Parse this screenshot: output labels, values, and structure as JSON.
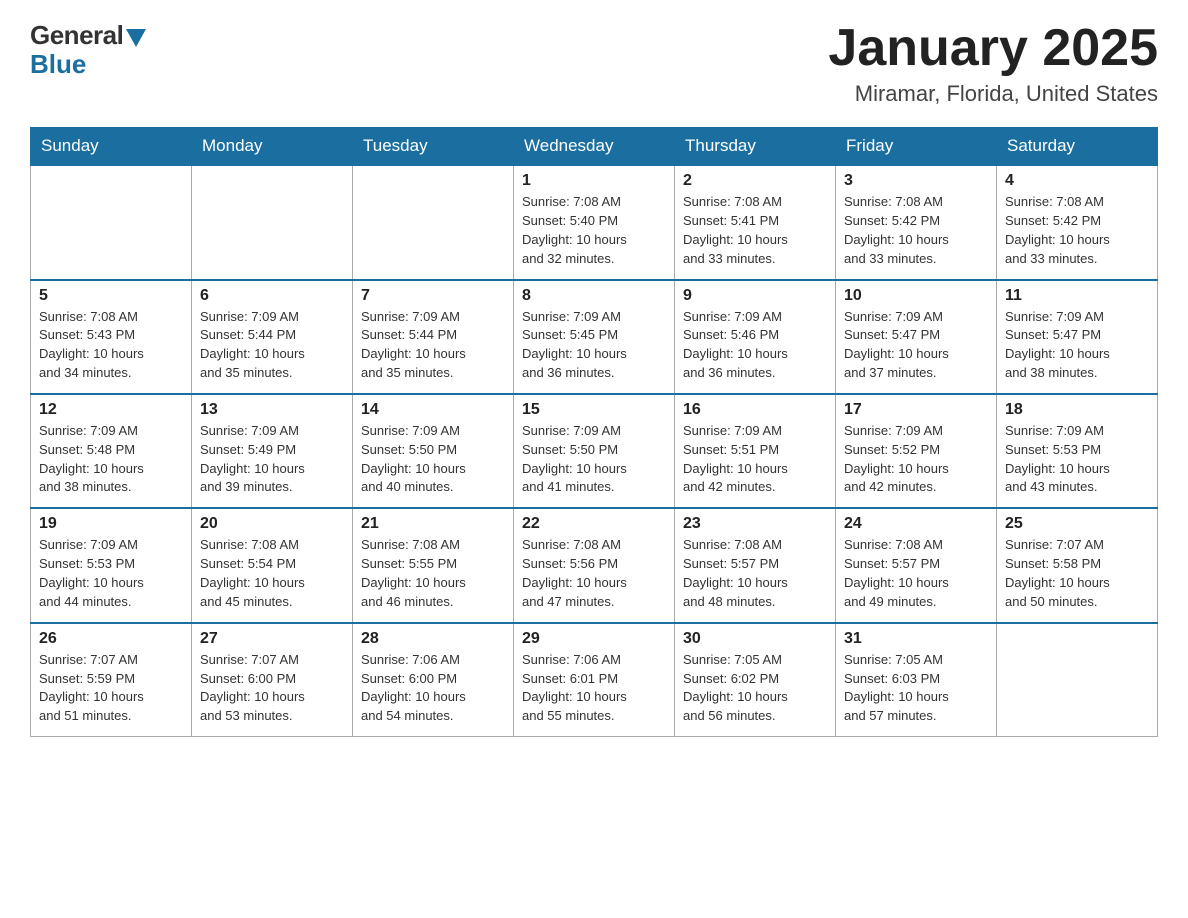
{
  "logo": {
    "general": "General",
    "blue": "Blue"
  },
  "title": "January 2025",
  "location": "Miramar, Florida, United States",
  "days_header": [
    "Sunday",
    "Monday",
    "Tuesday",
    "Wednesday",
    "Thursday",
    "Friday",
    "Saturday"
  ],
  "weeks": [
    [
      {
        "num": "",
        "info": ""
      },
      {
        "num": "",
        "info": ""
      },
      {
        "num": "",
        "info": ""
      },
      {
        "num": "1",
        "info": "Sunrise: 7:08 AM\nSunset: 5:40 PM\nDaylight: 10 hours\nand 32 minutes."
      },
      {
        "num": "2",
        "info": "Sunrise: 7:08 AM\nSunset: 5:41 PM\nDaylight: 10 hours\nand 33 minutes."
      },
      {
        "num": "3",
        "info": "Sunrise: 7:08 AM\nSunset: 5:42 PM\nDaylight: 10 hours\nand 33 minutes."
      },
      {
        "num": "4",
        "info": "Sunrise: 7:08 AM\nSunset: 5:42 PM\nDaylight: 10 hours\nand 33 minutes."
      }
    ],
    [
      {
        "num": "5",
        "info": "Sunrise: 7:08 AM\nSunset: 5:43 PM\nDaylight: 10 hours\nand 34 minutes."
      },
      {
        "num": "6",
        "info": "Sunrise: 7:09 AM\nSunset: 5:44 PM\nDaylight: 10 hours\nand 35 minutes."
      },
      {
        "num": "7",
        "info": "Sunrise: 7:09 AM\nSunset: 5:44 PM\nDaylight: 10 hours\nand 35 minutes."
      },
      {
        "num": "8",
        "info": "Sunrise: 7:09 AM\nSunset: 5:45 PM\nDaylight: 10 hours\nand 36 minutes."
      },
      {
        "num": "9",
        "info": "Sunrise: 7:09 AM\nSunset: 5:46 PM\nDaylight: 10 hours\nand 36 minutes."
      },
      {
        "num": "10",
        "info": "Sunrise: 7:09 AM\nSunset: 5:47 PM\nDaylight: 10 hours\nand 37 minutes."
      },
      {
        "num": "11",
        "info": "Sunrise: 7:09 AM\nSunset: 5:47 PM\nDaylight: 10 hours\nand 38 minutes."
      }
    ],
    [
      {
        "num": "12",
        "info": "Sunrise: 7:09 AM\nSunset: 5:48 PM\nDaylight: 10 hours\nand 38 minutes."
      },
      {
        "num": "13",
        "info": "Sunrise: 7:09 AM\nSunset: 5:49 PM\nDaylight: 10 hours\nand 39 minutes."
      },
      {
        "num": "14",
        "info": "Sunrise: 7:09 AM\nSunset: 5:50 PM\nDaylight: 10 hours\nand 40 minutes."
      },
      {
        "num": "15",
        "info": "Sunrise: 7:09 AM\nSunset: 5:50 PM\nDaylight: 10 hours\nand 41 minutes."
      },
      {
        "num": "16",
        "info": "Sunrise: 7:09 AM\nSunset: 5:51 PM\nDaylight: 10 hours\nand 42 minutes."
      },
      {
        "num": "17",
        "info": "Sunrise: 7:09 AM\nSunset: 5:52 PM\nDaylight: 10 hours\nand 42 minutes."
      },
      {
        "num": "18",
        "info": "Sunrise: 7:09 AM\nSunset: 5:53 PM\nDaylight: 10 hours\nand 43 minutes."
      }
    ],
    [
      {
        "num": "19",
        "info": "Sunrise: 7:09 AM\nSunset: 5:53 PM\nDaylight: 10 hours\nand 44 minutes."
      },
      {
        "num": "20",
        "info": "Sunrise: 7:08 AM\nSunset: 5:54 PM\nDaylight: 10 hours\nand 45 minutes."
      },
      {
        "num": "21",
        "info": "Sunrise: 7:08 AM\nSunset: 5:55 PM\nDaylight: 10 hours\nand 46 minutes."
      },
      {
        "num": "22",
        "info": "Sunrise: 7:08 AM\nSunset: 5:56 PM\nDaylight: 10 hours\nand 47 minutes."
      },
      {
        "num": "23",
        "info": "Sunrise: 7:08 AM\nSunset: 5:57 PM\nDaylight: 10 hours\nand 48 minutes."
      },
      {
        "num": "24",
        "info": "Sunrise: 7:08 AM\nSunset: 5:57 PM\nDaylight: 10 hours\nand 49 minutes."
      },
      {
        "num": "25",
        "info": "Sunrise: 7:07 AM\nSunset: 5:58 PM\nDaylight: 10 hours\nand 50 minutes."
      }
    ],
    [
      {
        "num": "26",
        "info": "Sunrise: 7:07 AM\nSunset: 5:59 PM\nDaylight: 10 hours\nand 51 minutes."
      },
      {
        "num": "27",
        "info": "Sunrise: 7:07 AM\nSunset: 6:00 PM\nDaylight: 10 hours\nand 53 minutes."
      },
      {
        "num": "28",
        "info": "Sunrise: 7:06 AM\nSunset: 6:00 PM\nDaylight: 10 hours\nand 54 minutes."
      },
      {
        "num": "29",
        "info": "Sunrise: 7:06 AM\nSunset: 6:01 PM\nDaylight: 10 hours\nand 55 minutes."
      },
      {
        "num": "30",
        "info": "Sunrise: 7:05 AM\nSunset: 6:02 PM\nDaylight: 10 hours\nand 56 minutes."
      },
      {
        "num": "31",
        "info": "Sunrise: 7:05 AM\nSunset: 6:03 PM\nDaylight: 10 hours\nand 57 minutes."
      },
      {
        "num": "",
        "info": ""
      }
    ]
  ]
}
